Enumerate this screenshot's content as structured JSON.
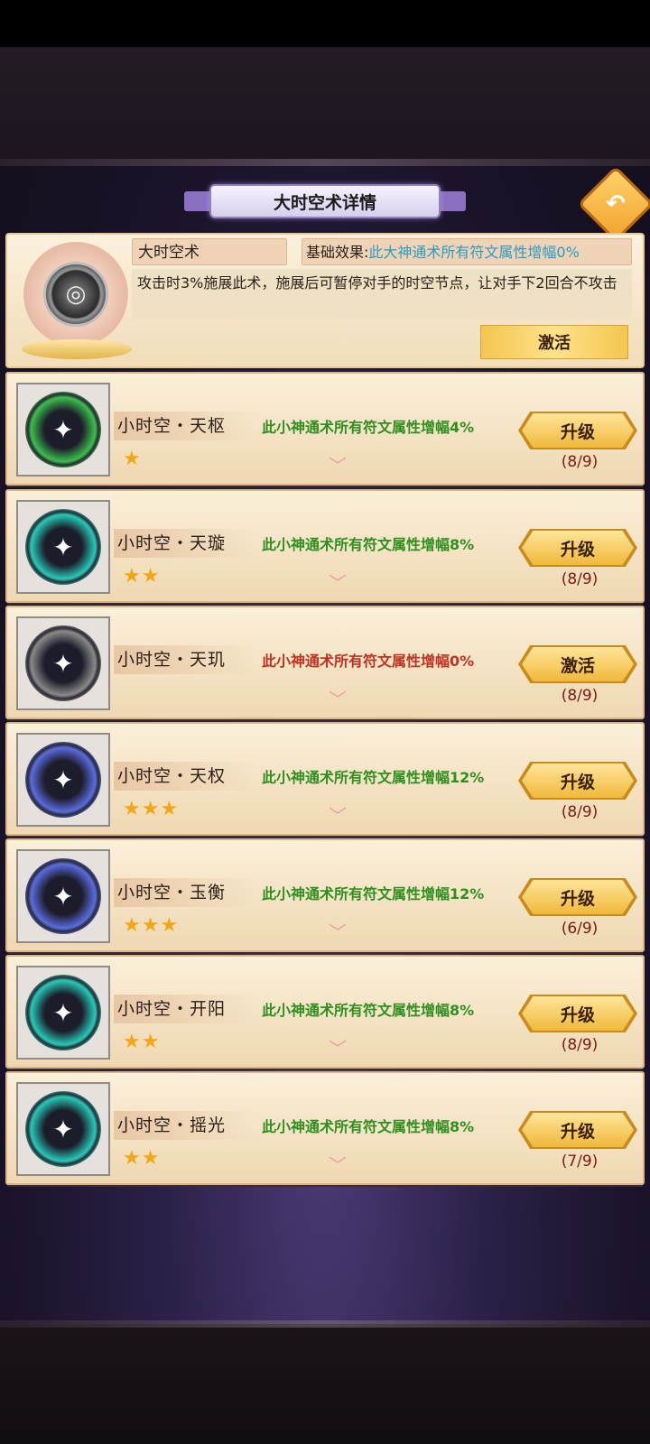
{
  "header": {
    "title": "大时空术详情"
  },
  "detail": {
    "name": "大时空术",
    "effect_label": "基础效果:",
    "effect_value": "此大神通术所有符文属性增幅0%",
    "description": "攻击时3%施展此术，施展后可暂停对手的时空节点，让对手下2回合不攻击",
    "action_label": "激活"
  },
  "runes": [
    {
      "name": "小时空・天枢",
      "stars": "★",
      "effect": "此小神通术所有符文属性增幅4%",
      "effect_color": "#2f8f1f",
      "button": "升级",
      "progress": "(8/9)",
      "orb_color": "#3bbf4c"
    },
    {
      "name": "小时空・天璇",
      "stars": "★★",
      "effect": "此小神通术所有符文属性增幅8%",
      "effect_color": "#2f8f1f",
      "button": "升级",
      "progress": "(8/9)",
      "orb_color": "#27c9b8"
    },
    {
      "name": "小时空・天玑",
      "stars": "",
      "effect": "此小神通术所有符文属性增幅0%",
      "effect_color": "#c03221",
      "button": "激活",
      "progress": "(8/9)",
      "orb_color": "#8a8a8a"
    },
    {
      "name": "小时空・天权",
      "stars": "★★★",
      "effect": "此小神通术所有符文属性增幅12%",
      "effect_color": "#2f8f1f",
      "button": "升级",
      "progress": "(8/9)",
      "orb_color": "#5a6de0"
    },
    {
      "name": "小时空・玉衡",
      "stars": "★★★",
      "effect": "此小神通术所有符文属性增幅12%",
      "effect_color": "#2f8f1f",
      "button": "升级",
      "progress": "(6/9)",
      "orb_color": "#5a6de0"
    },
    {
      "name": "小时空・开阳",
      "stars": "★★",
      "effect": "此小神通术所有符文属性增幅8%",
      "effect_color": "#2f8f1f",
      "button": "升级",
      "progress": "(8/9)",
      "orb_color": "#27c9b8"
    },
    {
      "name": "小时空・摇光",
      "stars": "★★",
      "effect": "此小神通术所有符文属性增幅8%",
      "effect_color": "#2f8f1f",
      "button": "升级",
      "progress": "(7/9)",
      "orb_color": "#27c9b8"
    }
  ]
}
